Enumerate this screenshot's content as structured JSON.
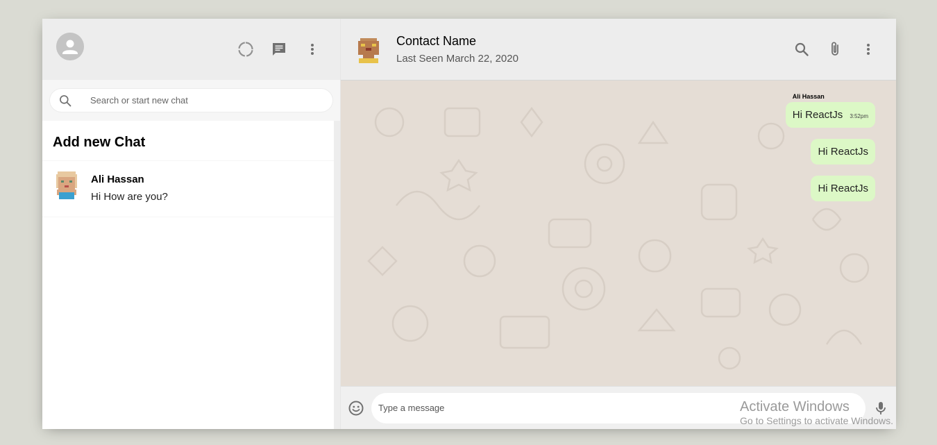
{
  "sidebar": {
    "search_placeholder": "Search or start new chat",
    "add_chat_label": "Add new Chat",
    "chats": [
      {
        "name": "Ali Hassan",
        "last_message": "Hi How are you?"
      }
    ]
  },
  "chat": {
    "contact_name": "Contact Name",
    "last_seen": "Last Seen March 22, 2020",
    "messages": [
      {
        "sender": "Ali Hassan",
        "text": "Hi ReactJs",
        "time": "3:52pm"
      },
      {
        "text": "Hi ReactJs"
      },
      {
        "text": "Hi ReactJs"
      }
    ],
    "input_placeholder": "Type a message"
  },
  "watermark": {
    "title": "Activate Windows",
    "subtitle": "Go to Settings to activate Windows."
  },
  "icons": {
    "status": "status-icon",
    "new_chat": "chat-icon",
    "menu": "more-vert-icon",
    "search": "search-icon",
    "attach": "attach-icon",
    "emoji": "emoji-icon",
    "mic": "mic-icon"
  },
  "colors": {
    "app_bg": "#dadbd3",
    "header_bg": "#ededed",
    "chat_bg": "#e5ddd5",
    "bubble": "#dcf8c6",
    "icon": "#919191"
  }
}
